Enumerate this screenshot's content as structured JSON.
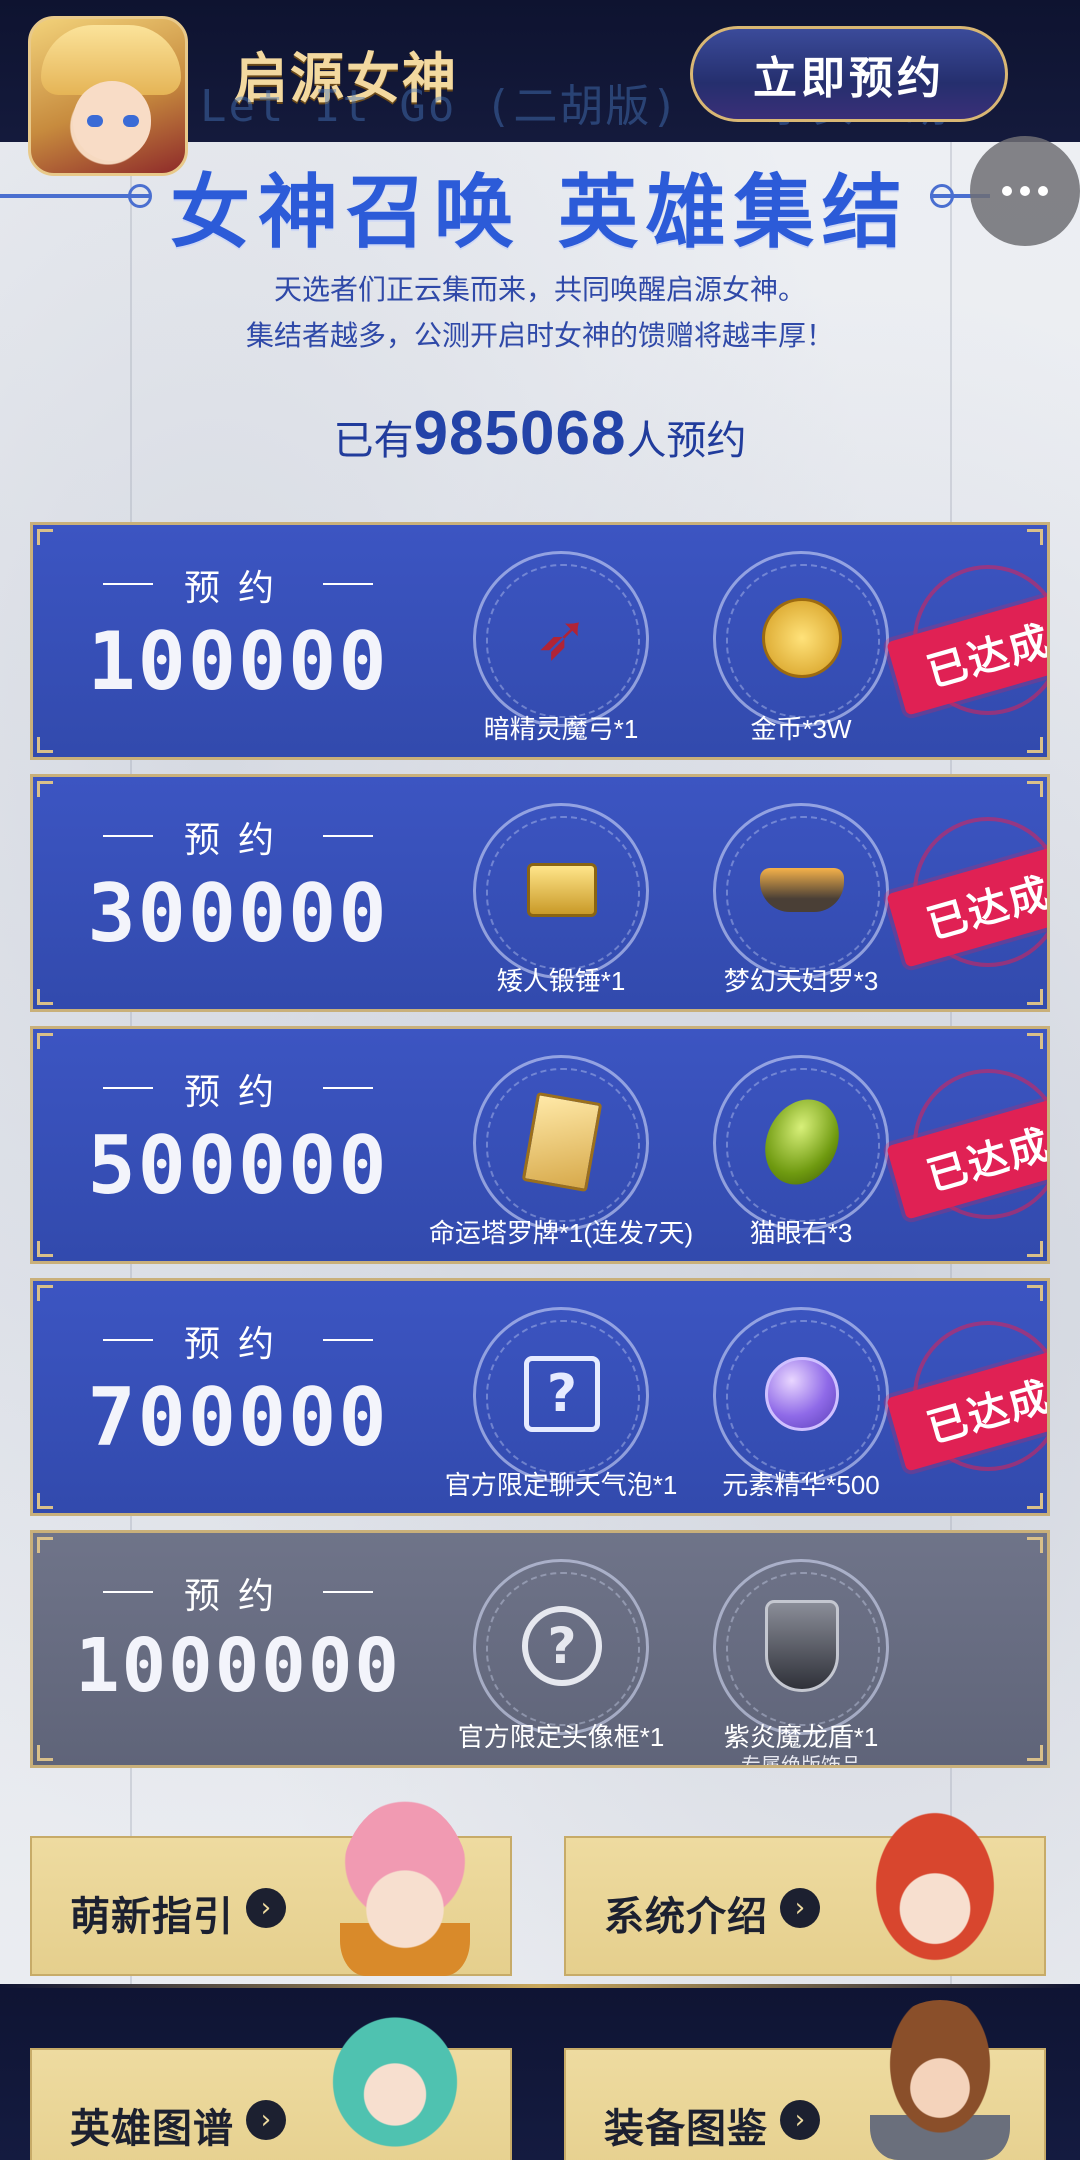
{
  "header": {
    "app_title": "启源女神",
    "watermark": "Let It Go (二胡版) - 永安二胡",
    "reserve_label": "立即预约",
    "more_label": "···"
  },
  "hero": {
    "title": "女神召唤 英雄集结",
    "line1": "天选者们正云集而来，共同唤醒启源女神。",
    "line2": "集结者越多，公测开启时女神的馈赠将越丰厚！",
    "count_prefix": "已有",
    "count_value": "985068",
    "count_suffix": "人预约"
  },
  "tiers": [
    {
      "label": "预约",
      "target": "100000",
      "state": "achieved",
      "stamp": "已达成",
      "rewards": [
        {
          "name": "暗精灵魔弓*1",
          "icon": "bow-icon"
        },
        {
          "name": "金币*3W",
          "icon": "gold-coin-icon"
        }
      ]
    },
    {
      "label": "预约",
      "target": "300000",
      "state": "achieved",
      "stamp": "已达成",
      "rewards": [
        {
          "name": "矮人锻锤*1",
          "icon": "hammer-icon"
        },
        {
          "name": "梦幻天妇罗*3",
          "icon": "tempura-icon"
        }
      ]
    },
    {
      "label": "预约",
      "target": "500000",
      "state": "achieved",
      "stamp": "已达成",
      "rewards": [
        {
          "name": "命运塔罗牌*1(连发7天)",
          "icon": "tarot-card-icon"
        },
        {
          "name": "猫眼石*3",
          "icon": "cats-eye-gem-icon"
        }
      ]
    },
    {
      "label": "预约",
      "target": "700000",
      "state": "achieved",
      "stamp": "已达成",
      "rewards": [
        {
          "name": "官方限定聊天气泡*1",
          "icon": "mystery-bubble-icon"
        },
        {
          "name": "元素精华*500",
          "icon": "potion-icon"
        }
      ]
    },
    {
      "label": "预约",
      "target": "1000000",
      "state": "locked",
      "stamp": "",
      "rewards": [
        {
          "name": "官方限定头像框*1",
          "icon": "mystery-frame-icon"
        },
        {
          "name": "紫炎魔龙盾*1",
          "icon": "dragon-shield-icon",
          "note": "专属绝版饰品"
        }
      ]
    }
  ],
  "nav": [
    {
      "label": "萌新指引",
      "icon": "arrow-right-icon"
    },
    {
      "label": "系统介绍",
      "icon": "arrow-right-icon"
    },
    {
      "label": "英雄图谱",
      "icon": "arrow-right-icon"
    },
    {
      "label": "装备图鉴",
      "icon": "arrow-right-icon"
    }
  ],
  "colors": {
    "accent": "#2c5bd8",
    "tier_active": "#3c55c2",
    "tier_locked": "#6f7489",
    "stamp": "#e02154",
    "card": "#eedba0"
  }
}
